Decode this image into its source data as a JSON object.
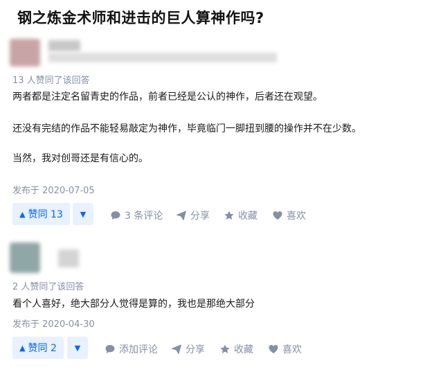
{
  "question": {
    "title": "钢之炼金术师和进击的巨人算神作吗?"
  },
  "answers": [
    {
      "votes_text": "13 人赞同了该回答",
      "paragraphs": [
        "两者都是注定名留青史的作品，前者已经是公认的神作，后者还在观望。",
        "还没有完结的作品不能轻易敲定为神作，毕竟临门一脚扭到腰的操作并不在少数。",
        "当然，我对创哥还是有信心的。"
      ],
      "date": "发布于 2020-07-05",
      "vote_label": "赞同 13",
      "comment_label": "3 条评论",
      "share_label": "分享",
      "collect_label": "收藏",
      "like_label": "喜欢"
    },
    {
      "votes_text": "2 人赞同了该回答",
      "paragraphs": [
        "看个人喜好，绝大部分人觉得是算的，我也是那绝大部分"
      ],
      "date": "发布于 2020-04-30",
      "vote_label": "赞同 2",
      "comment_label": "添加评论",
      "share_label": "分享",
      "collect_label": "收藏",
      "like_label": "喜欢"
    }
  ],
  "colors": {
    "accent": "#0066ff",
    "accent_bg": "#e8f1fd",
    "meta": "#8590a6",
    "text": "#1a1a1a"
  },
  "icons": {
    "upvote": "triangle-up-icon",
    "downvote": "triangle-down-icon",
    "comment": "comment-bubble-icon",
    "share": "paper-plane-icon",
    "collect": "star-icon",
    "like": "heart-icon"
  }
}
